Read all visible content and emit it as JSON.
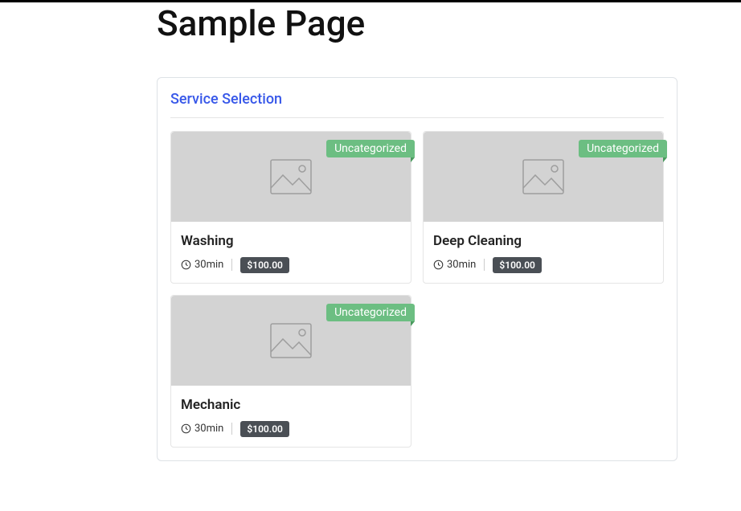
{
  "page": {
    "title": "Sample Page"
  },
  "section": {
    "title": "Service Selection"
  },
  "services": [
    {
      "name": "Washing",
      "duration": "30min",
      "price": "$100.00",
      "category": "Uncategorized"
    },
    {
      "name": "Deep Cleaning",
      "duration": "30min",
      "price": "$100.00",
      "category": "Uncategorized"
    },
    {
      "name": "Mechanic",
      "duration": "30min",
      "price": "$100.00",
      "category": "Uncategorized"
    }
  ]
}
